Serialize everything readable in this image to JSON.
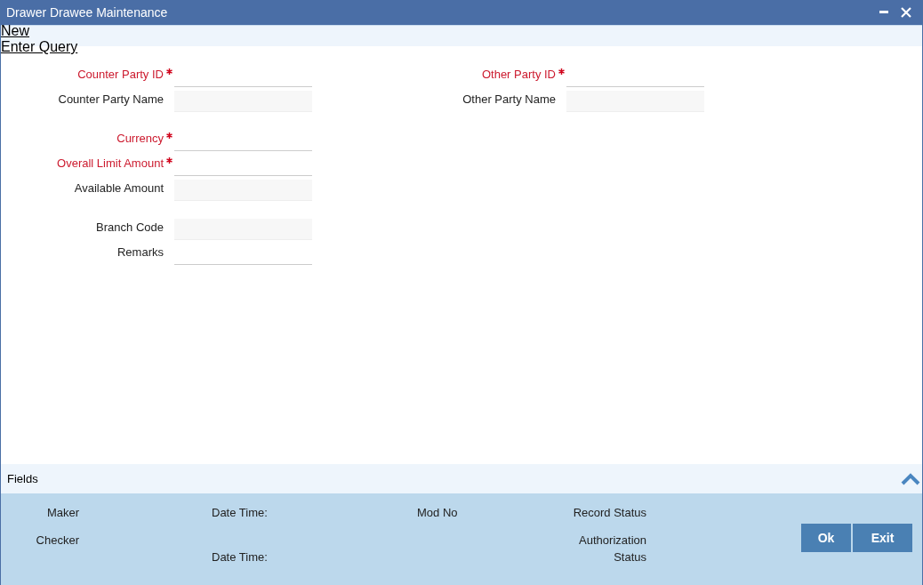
{
  "window": {
    "title": "Drawer Drawee Maintenance"
  },
  "actions": [
    "New",
    "Enter Query"
  ],
  "form": {
    "left_groups": [
      [
        {
          "label": "Counter Party ID",
          "required": true,
          "readonly": false
        },
        {
          "label": "Counter Party Name",
          "required": false,
          "readonly": true
        }
      ],
      [
        {
          "label": "Currency",
          "required": true,
          "readonly": false
        },
        {
          "label": "Overall Limit Amount",
          "required": true,
          "readonly": false
        },
        {
          "label": "Available Amount",
          "required": false,
          "readonly": true
        }
      ],
      [
        {
          "label": "Branch Code",
          "required": false,
          "readonly": true
        },
        {
          "label": "Remarks",
          "required": false,
          "readonly": false
        }
      ]
    ],
    "right_groups": [
      [
        {
          "label": "Other Party ID",
          "required": true,
          "readonly": false
        },
        {
          "label": "Other Party Name",
          "required": false,
          "readonly": true
        }
      ]
    ]
  },
  "fields_bar": {
    "label": "Fields",
    "expanded": true
  },
  "audit": {
    "maker": "Maker",
    "checker": "Checker",
    "date_time_1": "Date Time:",
    "date_time_2": "Date Time:",
    "mod_no": "Mod No",
    "record_status": "Record Status",
    "authorization_status": "Authorization Status"
  },
  "buttons": [
    "Ok",
    "Exit"
  ]
}
